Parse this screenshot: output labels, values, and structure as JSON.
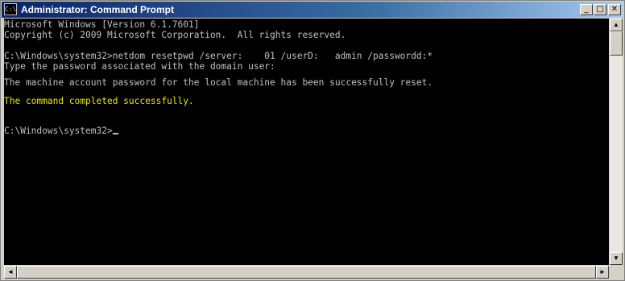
{
  "window": {
    "title": "Administrator: Command Prompt",
    "icon": "cmd-icon",
    "icon_text": "C:\\",
    "controls": {
      "minimize": "_",
      "maximize": "□",
      "close": "✕"
    }
  },
  "console": {
    "lines": [
      "Microsoft Windows [Version 6.1.7601]",
      "Copyright (c) 2009 Microsoft Corporation.  All rights reserved.",
      "",
      "C:\\Windows\\system32>netdom resetpwd /server:    01 /userD:   admin /passwordd:*",
      "Type the password associated with the domain user:",
      "",
      "The machine account password for the local machine has been successfully reset.",
      "",
      "The command completed successfully.",
      "",
      "",
      "C:\\Windows\\system32>"
    ],
    "text_color": "#c0c0c0",
    "success_color": "#e6e600",
    "background": "#000000"
  },
  "scrollbars": {
    "up_arrow": "▲",
    "down_arrow": "▼",
    "left_arrow": "◄",
    "right_arrow": "►"
  }
}
